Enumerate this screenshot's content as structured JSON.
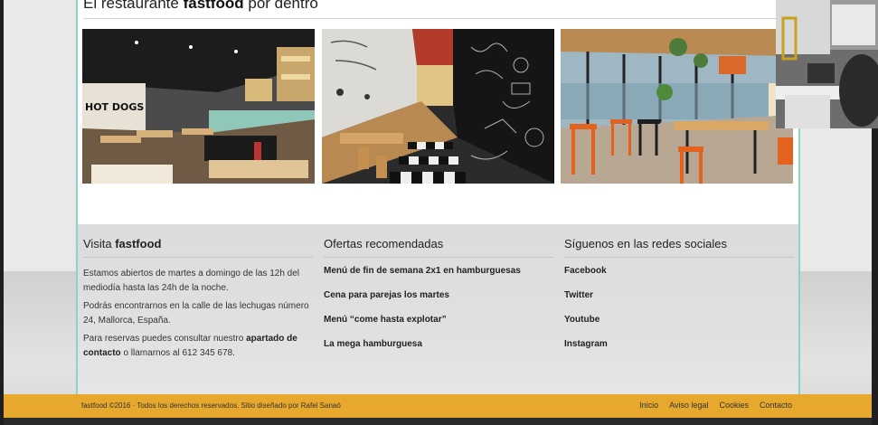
{
  "gallery": {
    "title_prefix": "El restaurante",
    "title_brand": "fastfood",
    "title_suffix": "por dentro"
  },
  "photo_texts": {
    "hot_dogs": "HOT DOGS"
  },
  "footer": {
    "visit": {
      "title_prefix": "Visita",
      "title_brand": "fastfood",
      "paragraph1": "Estamos abiertos de martes a domingo de las 12h del mediodía hasta las 24h de la noche.",
      "paragraph2": "Podrás encontrarnos en la calle de las lechugas número 24, Mallorca, España.",
      "paragraph3_a": "Para reservas puedes consultar nuestro",
      "paragraph3_link": "apartado de contacto",
      "paragraph3_b": "o llamarnos al 612 345 678."
    },
    "offers": {
      "title": "Ofertas recomendadas",
      "items": [
        "Menú de fin de semana 2x1 en hamburguesas",
        "Cena para parejas los martes",
        "Menú “come hasta explotar”",
        "La mega hamburguesa"
      ]
    },
    "social": {
      "title": "Síguenos en las redes sociales",
      "items": [
        "Facebook",
        "Twitter",
        "Youtube",
        "Instagram"
      ]
    }
  },
  "bottom_bar": {
    "copyright": "fastfood ©2016 · Todos los derechos reservados. Sitio diseñado por Rafel Sanaó",
    "nav": [
      "Inicio",
      "Aviso legal",
      "Cookies",
      "Contacto"
    ]
  },
  "colors": {
    "accent_bar": "#e7a82e",
    "border_teal": "#8fd0cf"
  }
}
